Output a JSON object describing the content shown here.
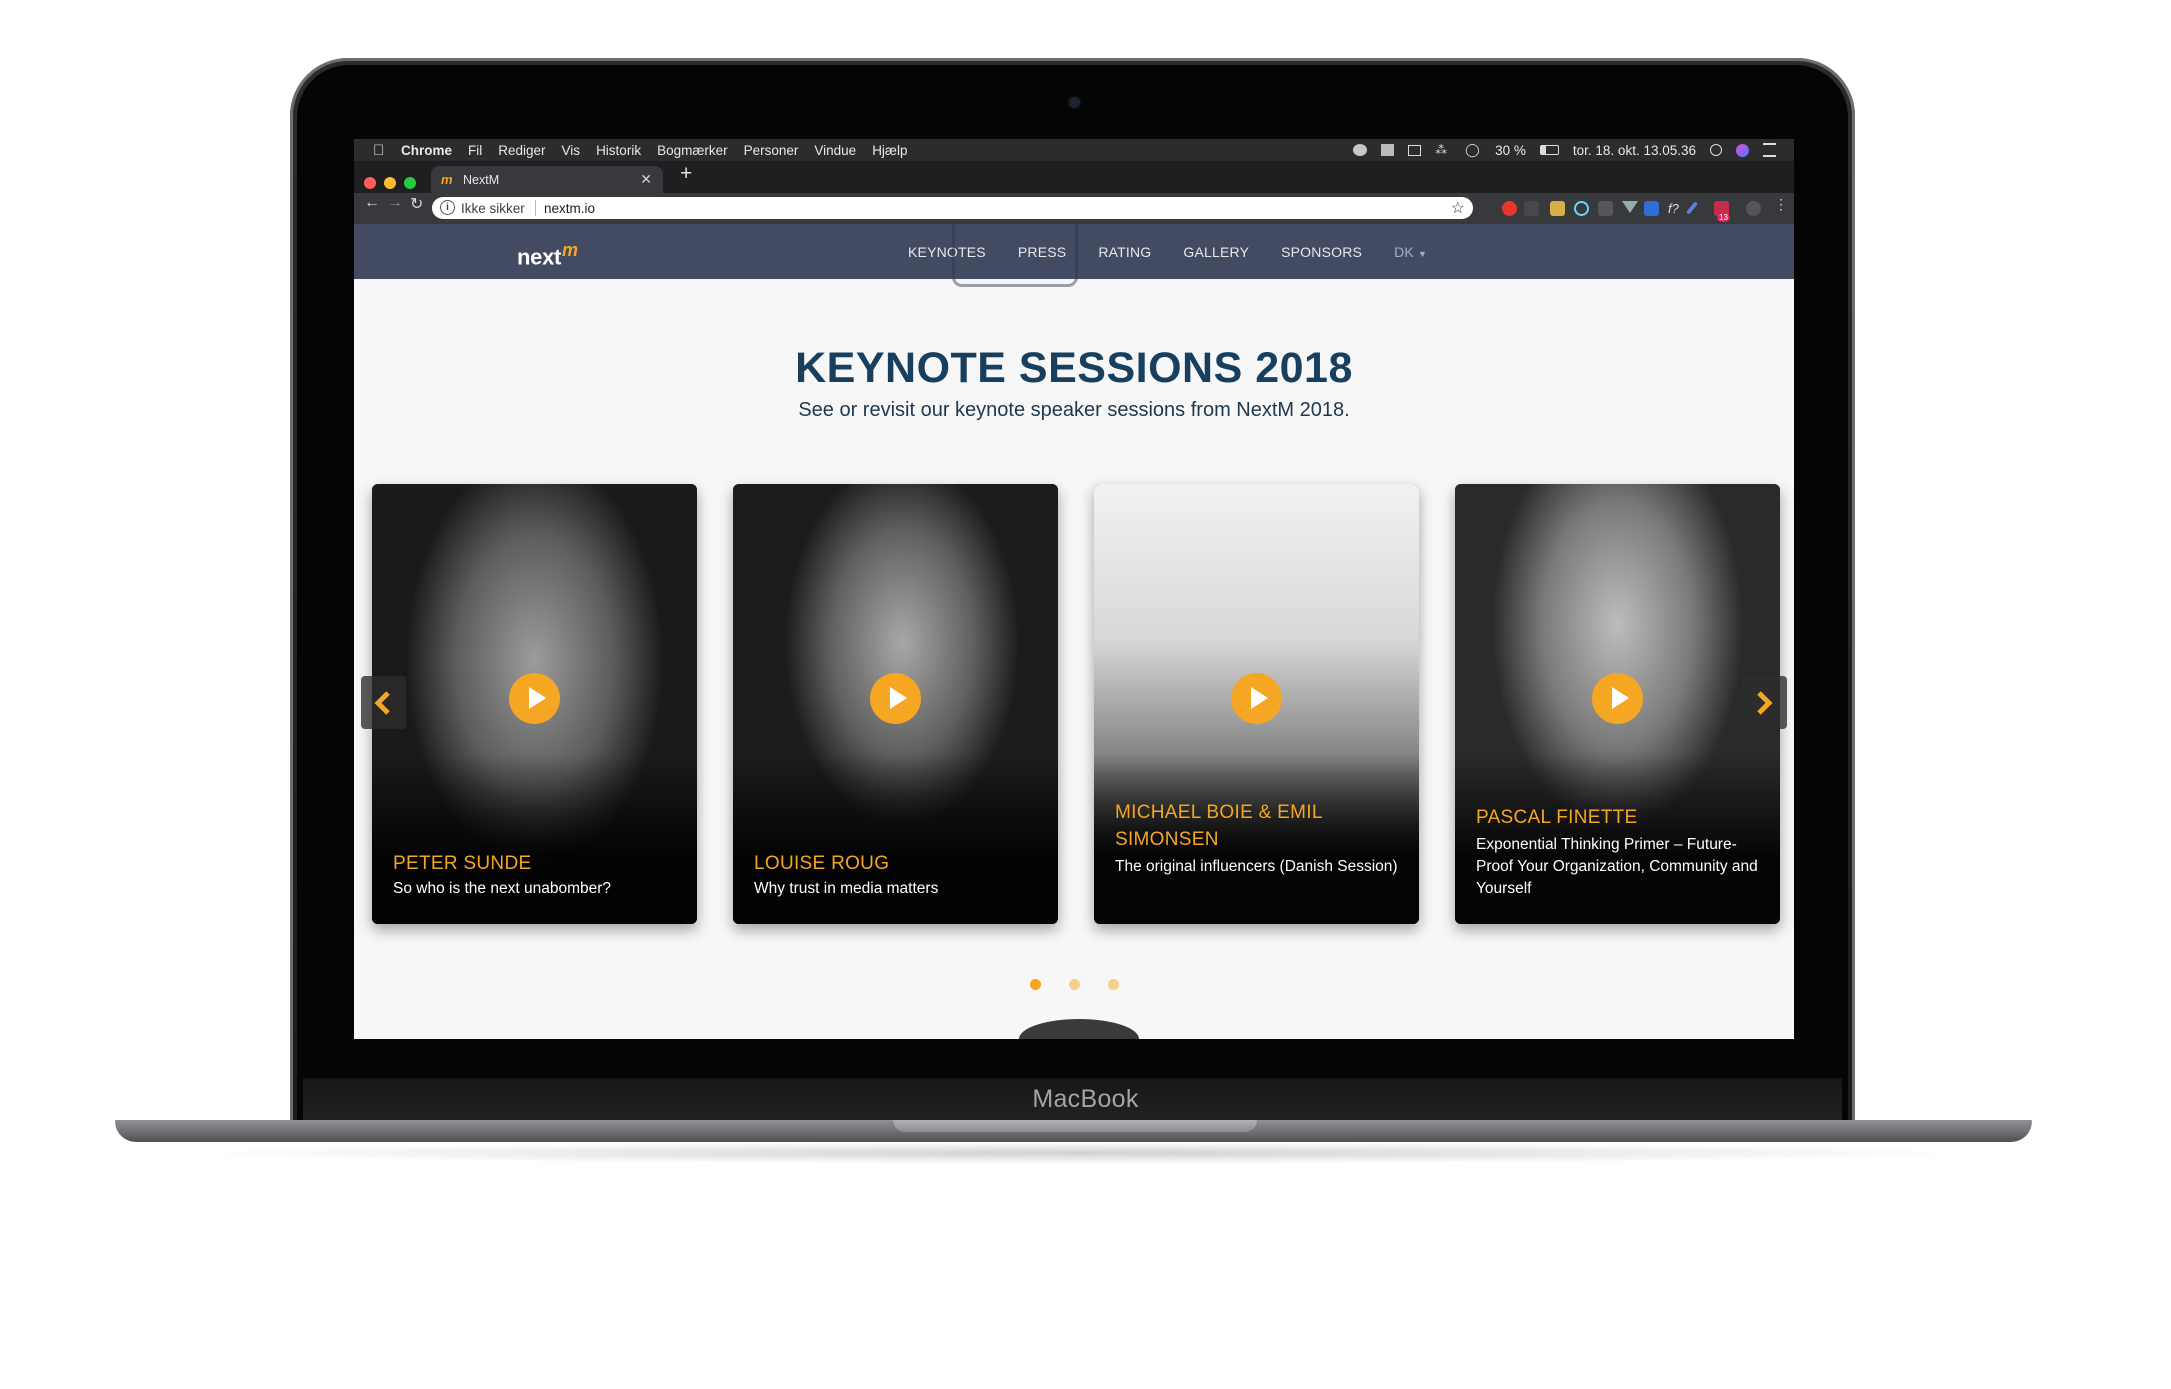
{
  "device": {
    "brand": "MacBook"
  },
  "mac_menubar": {
    "app": "Chrome",
    "items": [
      "Fil",
      "Rediger",
      "Vis",
      "Historik",
      "Bogmærker",
      "Personer",
      "Vindue",
      "Hjælp"
    ],
    "battery": "30 %",
    "clock": "tor. 18. okt.  13.05.36"
  },
  "browser": {
    "tab_title": "NextM",
    "security_label": "Ikke sikker",
    "url": "nextm.io",
    "extension_badge": "13"
  },
  "site": {
    "logo_text": "next",
    "logo_mark": "m",
    "nav": [
      "KEYNOTES",
      "PRESS",
      "RATING",
      "GALLERY",
      "SPONSORS"
    ],
    "language": "DK"
  },
  "section": {
    "title": "KEYNOTE SESSIONS 2018",
    "subtitle": "See or revisit our keynote speaker sessions from NextM 2018."
  },
  "cards": [
    {
      "name": "PETER SUNDE",
      "talk": "So who is the next unabomber?"
    },
    {
      "name": "LOUISE ROUG",
      "talk": "Why trust in media matters"
    },
    {
      "name": "MICHAEL BOIE & EMIL SIMONSEN",
      "talk": "The original influencers (Danish Session)"
    },
    {
      "name": "PASCAL FINETTE",
      "talk": "Exponential Thinking Primer – Future-Proof Your Organization, Community and Yourself"
    }
  ],
  "carousel": {
    "pages": 3,
    "active": 1
  },
  "colors": {
    "accent": "#f5a623",
    "nav_bg": "#424b62",
    "heading": "#18405e",
    "page_bg": "#f7f7f8"
  }
}
